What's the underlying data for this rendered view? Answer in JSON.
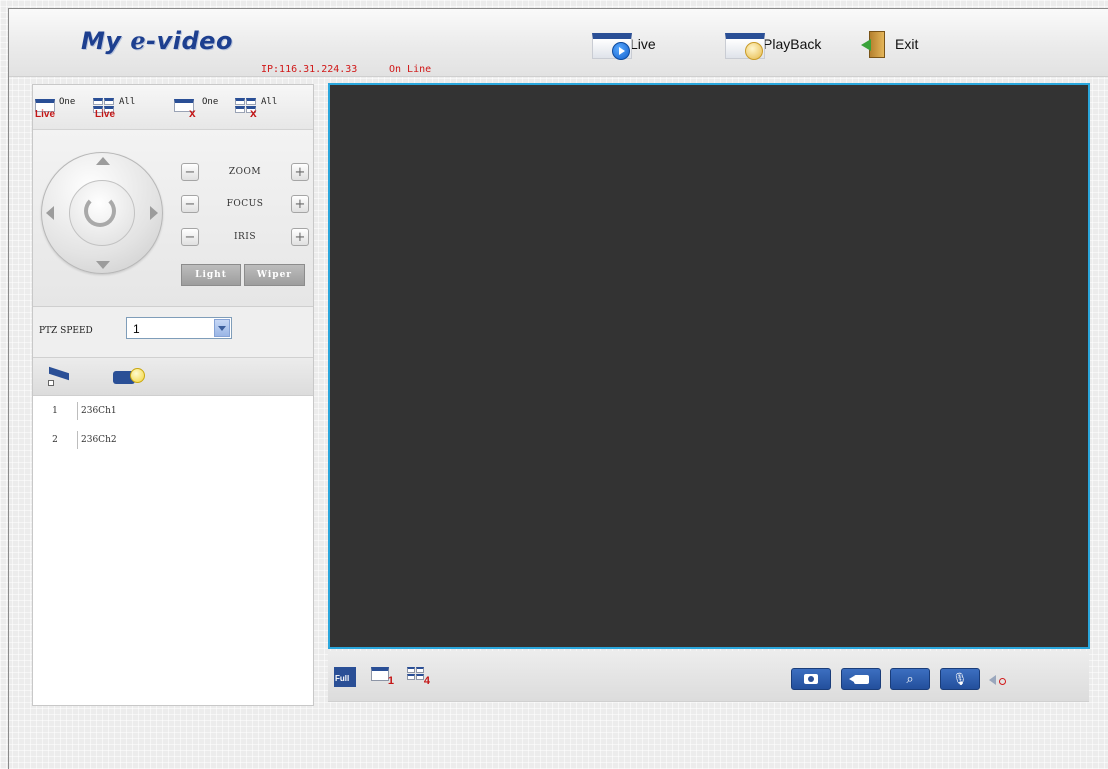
{
  "header": {
    "logo_text": "My ℯ-video",
    "ip_status": "IP:116.31.224.33",
    "online_status": "On Line",
    "nav": {
      "live": "Live",
      "playback": "PlayBack",
      "exit": "Exit"
    }
  },
  "toolbar": {
    "live_one": {
      "top": "One",
      "word": "Live"
    },
    "live_all": {
      "top": "All",
      "word": "Live"
    },
    "close_one": {
      "top": "One",
      "word": "x"
    },
    "close_all": {
      "top": "All",
      "word": "x"
    }
  },
  "ptz": {
    "controls": [
      {
        "name": "ZOOM",
        "minus": "−",
        "plus": "+"
      },
      {
        "name": "FOCUS",
        "minus": "−",
        "plus": "+"
      },
      {
        "name": "IRIS",
        "minus": "−",
        "plus": "+"
      }
    ],
    "light_label": "Light",
    "wiper_label": "Wiper",
    "speed_label": "PTZ SPEED",
    "speed_value": "1"
  },
  "channels": [
    {
      "num": "1",
      "name": "236Ch1"
    },
    {
      "num": "2",
      "name": "236Ch2"
    }
  ],
  "video_toolbar": {
    "full_label": "Full",
    "one_label": "1",
    "four_label": "4",
    "zoom_glyph": "⌕",
    "mic_glyph": "🎙"
  },
  "colors": {
    "accent": "#2a4f96",
    "video_border": "#2aa7dd",
    "status_red": "#d01818"
  }
}
